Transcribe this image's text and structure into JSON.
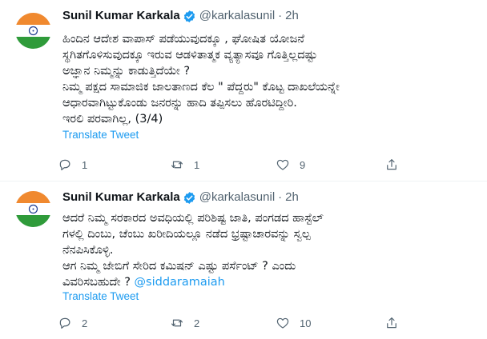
{
  "colors": {
    "link": "#1d9bf0",
    "muted": "#536471",
    "text": "#0f1419",
    "verified": "#1d9bf0",
    "flag_saffron": "#f0892f",
    "flag_green": "#2f9b3a",
    "flag_chakra": "#1f3d8f"
  },
  "tweets": [
    {
      "author_name": "Sunil Kumar Karkala",
      "handle": "@karkalasunil",
      "separator": "·",
      "time": "2h",
      "text": "ಹಿಂದಿನ ಆದೇಶ ವಾಪಾಸ್ ಪಡೆಯುವುದಕ್ಕೂ , ಘೋಷಿತ ಯೋಜನೆ\nಸ್ಥಗಿತಗೊಳಿಸುವುದಕ್ಕೂ ಇರುವ ಆಡಳಿತಾತ್ಮಕ ವ್ಯತ್ಯಾಸವೂ ಗೊತ್ತಿಲ್ಲದಷ್ಟು\nಅಜ್ಞಾನ ನಿಮ್ಮನ್ನು ಕಾಡುತ್ತಿದೆಯೇ ?\nನಿಮ್ಮ ಪಕ್ಷದ ಸಾಮಾಜಿಕ ಜಾಲತಾಣದ ಕೆಲ \" ಪೆದ್ದರು\" ಕೊಟ್ಟ ದಾಖಲೆಯನ್ನೇ\nಆಧಾರವಾಗಿಟ್ಟುಕೊಂಡು ಜನರನ್ನು ಹಾದಿ ತಪ್ಪಿಸಲು ಹೊರಟಿದ್ದೀರಿ.\nಇರಲಿ ಪರವಾಗಿಲ್ಲ, (3/4)",
      "mention": "",
      "translate_label": "Translate Tweet",
      "reply_count": "1",
      "retweet_count": "1",
      "like_count": "9",
      "icons": {
        "reply": "reply-icon",
        "retweet": "retweet-icon",
        "like": "heart-icon",
        "share": "share-icon",
        "verified": "verified-badge-icon",
        "avatar": "indian-flag-avatar"
      }
    },
    {
      "author_name": "Sunil Kumar Karkala",
      "handle": "@karkalasunil",
      "separator": "·",
      "time": "2h",
      "text": "ಆದರೆ ನಿಮ್ಮ ಸರಕಾರದ ಅವಧಿಯಲ್ಲಿ ಪರಿಶಿಷ್ಟ ಜಾತಿ, ಪಂಗಡದ ಹಾಸ್ಟೆಲ್\nಗಳಲ್ಲಿ ದಿಂಬು, ಚೆಂಬು ಖರೀದಿಯಲ್ಲೂ ನಡೆದ ಭ್ರಷ್ಟಾಚಾರವನ್ನು ಸ್ವಲ್ಪ\nನೆನಪಿಸಿಕೊಳ್ಳಿ.\nಆಗ ನಿಮ್ಮ ಜೇಬಿಗೆ ಸೇರಿದ ಕಮಿಷನ್ ಎಷ್ಟು ಪರ್ಸೆಂಟ್ ? ಎಂದು\nವಿವರಿಸಬಹುದೇ ? ",
      "mention": "@siddaramaiah",
      "translate_label": "Translate Tweet",
      "reply_count": "2",
      "retweet_count": "2",
      "like_count": "10",
      "icons": {
        "reply": "reply-icon",
        "retweet": "retweet-icon",
        "like": "heart-icon",
        "share": "share-icon",
        "verified": "verified-badge-icon",
        "avatar": "indian-flag-avatar"
      }
    }
  ]
}
